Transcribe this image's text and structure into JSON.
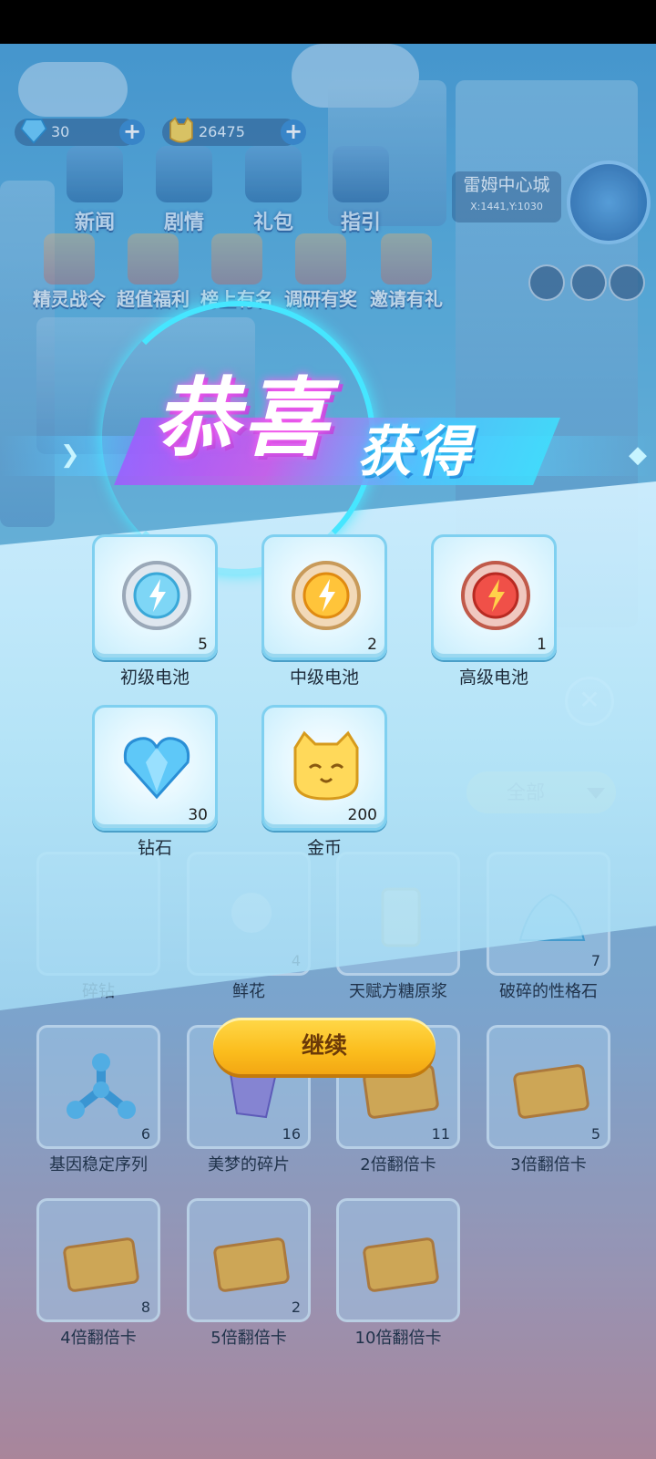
{
  "hud": {
    "diamond_count": "30",
    "coin_count": "26475",
    "menu": [
      {
        "label": "新闻"
      },
      {
        "label": "剧情"
      },
      {
        "label": "礼包"
      },
      {
        "label": "指引"
      }
    ],
    "events": [
      {
        "label": "精灵战令"
      },
      {
        "label": "超值福利"
      },
      {
        "label": "榜上有名"
      },
      {
        "label": "调研有奖"
      },
      {
        "label": "邀请有礼"
      }
    ],
    "city": {
      "name": "雷姆中心城",
      "coord": "X:1441,Y:1030"
    }
  },
  "popup": {
    "title_main": "恭喜",
    "title_sub": "获得",
    "rewards": [
      {
        "name": "初级电池",
        "qty": "5",
        "icon": "silver-battery-gear-icon"
      },
      {
        "name": "中级电池",
        "qty": "2",
        "icon": "gold-battery-gear-icon"
      },
      {
        "name": "高级电池",
        "qty": "1",
        "icon": "red-battery-gear-icon"
      },
      {
        "name": "钻石",
        "qty": "30",
        "icon": "blue-heart-diamond-icon"
      },
      {
        "name": "金币",
        "qty": "200",
        "icon": "cat-coin-icon"
      }
    ],
    "continue_label": "继续"
  },
  "inventory": {
    "filter_label": "全部",
    "items": [
      {
        "name": "碎钻",
        "qty": ""
      },
      {
        "name": "鲜花",
        "qty": "4"
      },
      {
        "name": "天赋方糖原浆",
        "qty": ""
      },
      {
        "name": "破碎的性格石",
        "qty": "7"
      },
      {
        "name": "基因稳定序列",
        "qty": "6"
      },
      {
        "name": "美梦的碎片",
        "qty": "16"
      },
      {
        "name": "2倍翻倍卡",
        "qty": "11"
      },
      {
        "name": "3倍翻倍卡",
        "qty": "5"
      },
      {
        "name": "4倍翻倍卡",
        "qty": "8"
      },
      {
        "name": "5倍翻倍卡",
        "qty": "2"
      },
      {
        "name": "10倍翻倍卡",
        "qty": ""
      }
    ]
  },
  "colors": {
    "accent_cyan": "#46e6ff",
    "button_yellow": "#fbbd1d",
    "title_magenta": "#d05ae8"
  }
}
